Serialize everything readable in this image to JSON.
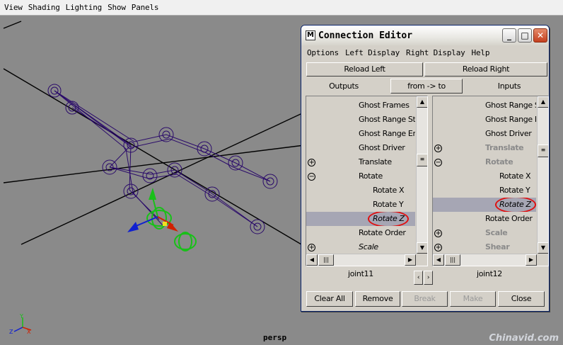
{
  "viewport": {
    "menu": [
      "View",
      "Shading",
      "Lighting",
      "Show",
      "Panels"
    ],
    "camera_label": "persp",
    "watermark": "Chinavid.com"
  },
  "window": {
    "title": "Connection Editor",
    "logo": "M",
    "menu": [
      "Options",
      "Left Display",
      "Right Display",
      "Help"
    ],
    "reload_left": "Reload Left",
    "reload_right": "Reload Right",
    "outputs_label": "Outputs",
    "direction": "from -> to",
    "inputs_label": "Inputs",
    "left_node": "joint11",
    "right_node": "joint12",
    "buttons": {
      "clear_all": "Clear All",
      "remove": "Remove",
      "break": "Break",
      "make": "Make",
      "close": "Close"
    }
  },
  "left_list": [
    {
      "label": "Ghost Frames",
      "indent": 1,
      "toggle": "",
      "style": "normal"
    },
    {
      "label": "Ghost Range Start",
      "indent": 1,
      "toggle": "",
      "style": "normal"
    },
    {
      "label": "Ghost Range End",
      "indent": 1,
      "toggle": "",
      "style": "normal"
    },
    {
      "label": "Ghost Driver",
      "indent": 1,
      "toggle": "",
      "style": "normal"
    },
    {
      "label": "Translate",
      "indent": 1,
      "toggle": "plus",
      "style": "normal"
    },
    {
      "label": "Rotate",
      "indent": 1,
      "toggle": "minus",
      "style": "normal"
    },
    {
      "label": "Rotate X",
      "indent": 2,
      "toggle": "",
      "style": "normal"
    },
    {
      "label": "Rotate Y",
      "indent": 2,
      "toggle": "",
      "style": "normal"
    },
    {
      "label": "Rotate Z",
      "indent": 2,
      "toggle": "",
      "style": "selected-italic"
    },
    {
      "label": "Rotate Order",
      "indent": 1,
      "toggle": "",
      "style": "normal"
    },
    {
      "label": "Scale",
      "indent": 1,
      "toggle": "plus",
      "style": "italic"
    },
    {
      "label": "",
      "indent": 1,
      "toggle": "plus",
      "style": "normal"
    }
  ],
  "right_list": [
    {
      "label": "Ghost Range Start",
      "indent": 1,
      "toggle": "",
      "style": "normal"
    },
    {
      "label": "Ghost Range End",
      "indent": 1,
      "toggle": "",
      "style": "normal"
    },
    {
      "label": "Ghost Driver",
      "indent": 1,
      "toggle": "",
      "style": "normal"
    },
    {
      "label": "Translate",
      "indent": 1,
      "toggle": "plus",
      "style": "grey"
    },
    {
      "label": "Rotate",
      "indent": 1,
      "toggle": "minus",
      "style": "grey"
    },
    {
      "label": "Rotate X",
      "indent": 2,
      "toggle": "",
      "style": "normal"
    },
    {
      "label": "Rotate Y",
      "indent": 2,
      "toggle": "",
      "style": "normal"
    },
    {
      "label": "Rotate Z",
      "indent": 2,
      "toggle": "",
      "style": "selected-italic"
    },
    {
      "label": "Rotate Order",
      "indent": 1,
      "toggle": "",
      "style": "normal"
    },
    {
      "label": "Scale",
      "indent": 1,
      "toggle": "plus",
      "style": "grey"
    },
    {
      "label": "Shear",
      "indent": 1,
      "toggle": "plus",
      "style": "grey"
    },
    {
      "label": "",
      "indent": 1,
      "toggle": "plus",
      "style": "normal"
    }
  ],
  "colors": {
    "viewport_bg": "#8a8a8a",
    "skeleton": "#2a0a6a",
    "selection_row": "#a6a6b4",
    "annotation": "#e01010",
    "manipulator_green": "#18c018",
    "manipulator_red": "#d02000",
    "manipulator_blue": "#1020d0"
  }
}
